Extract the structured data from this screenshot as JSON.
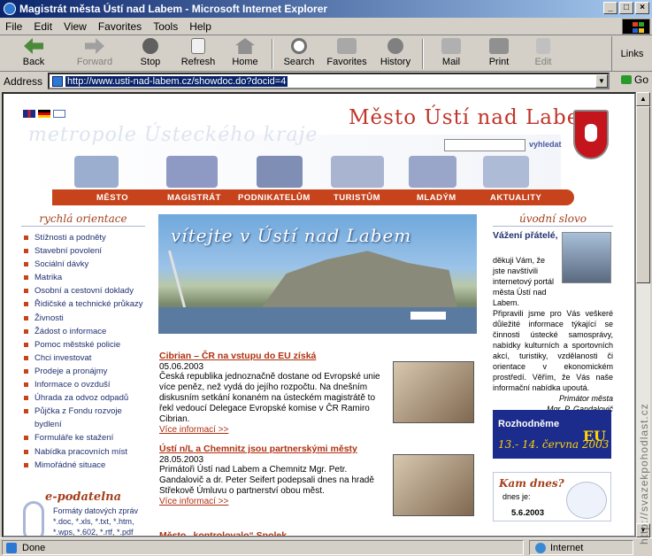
{
  "window": {
    "title": "Magistrát města Ústí nad Labem - Microsoft Internet Explorer",
    "min": "_",
    "max": "□",
    "close": "×"
  },
  "menu": [
    "File",
    "Edit",
    "View",
    "Favorites",
    "Tools",
    "Help"
  ],
  "toolbar": {
    "back": "Back",
    "forward": "Forward",
    "stop": "Stop",
    "refresh": "Refresh",
    "home": "Home",
    "search": "Search",
    "favorites": "Favorites",
    "history": "History",
    "mail": "Mail",
    "print": "Print",
    "edit": "Edit",
    "links": "Links"
  },
  "address": {
    "label": "Address",
    "url": "http://www.usti-nad-labem.cz/showdoc.do?docid=4",
    "go": "Go"
  },
  "status": {
    "text": "Done",
    "zone": "Internet"
  },
  "watermark": "http://svazekpohodlast.cz",
  "site": {
    "title": "Město Ústí nad Labem",
    "slogan": "metropole Ústeckého kraje",
    "search_label": "vyhledat",
    "nav": [
      "MĚSTO",
      "MAGISTRÁT",
      "PODNIKATELŮM",
      "TURISTŮM",
      "MLADÝM",
      "AKTUALITY"
    ],
    "quick_title": "rychlá orientace",
    "quick": [
      "Stížnosti a podněty",
      "Stavební povolení",
      "Sociální dávky",
      "Matrika",
      "Osobní a cestovní doklady",
      "Řidičské a technické průkazy",
      "Živnosti",
      "Žádost o informace",
      "Pomoc městské policie",
      "Chci investovat",
      "Prodeje a pronájmy",
      "Informace o ovzduší",
      "Úhrada za odvoz odpadů",
      "Půjčka z Fondu rozvoje bydlení",
      "Formuláře ke stažení",
      "Nabídka pracovních míst",
      "Mimořádné situace"
    ],
    "epodatelna": {
      "title": "e-podatelna",
      "desc": "Formáty datových zpráv *.doc, *.xls, *.txt, *.htm, *.wps, *.602, *.rtf, *.pdf"
    },
    "banner": "vítejte v Ústí nad Labem",
    "news": [
      {
        "title": "Cibrian – ČR na vstupu do EU získá",
        "date": "05.06.2003",
        "text": "Česká republika jednoznačně dostane od Evropské unie více peněz, než vydá do jejího rozpočtu. Na dnešním diskusním setkání konaném na ústeckém magistrátě to řekl vedoucí Delegace Evropské komise v ČR Ramiro Cibrian.",
        "more": "Více informací >>"
      },
      {
        "title": "Ústí n/L a Chemnitz jsou partnerskými městy",
        "date": "28.05.2003",
        "text": "Primátoři Ústí nad Labem a Chemnitz Mgr. Petr. Gandalovič a dr. Peter Seifert podepsali dnes na hradě Střekově Úmluvu o partnerství obou měst.",
        "more": "Více informací >>"
      }
    ],
    "news3_title": "Město „kontrolovalo“ Spolek",
    "welcome": {
      "title": "úvodní slovo",
      "greet": "Vážení přátelé,",
      "text1": "děkuji Vám, že jste navštívili internetový portál města Ústí nad Labem.",
      "text2": "Připravili jsme pro Vás veškeré důležité informace týkající se činnosti ústecké samosprávy, nabídky kulturních a sportovních akcí, turistiky, vzdělanosti či orientace v ekonomickém prostředí. Věřím, že Vás naše informační nabídka upoutá.",
      "sig1": "Primátor města",
      "sig2": "Mgr. P. Gandalovič"
    },
    "eu": {
      "a": "Rozhodněme",
      "b": "13.- 14. června 2003",
      "c": "EU"
    },
    "kam": {
      "title": "Kam dnes?",
      "label": "dnes je:",
      "date": "5.6.2003"
    }
  }
}
